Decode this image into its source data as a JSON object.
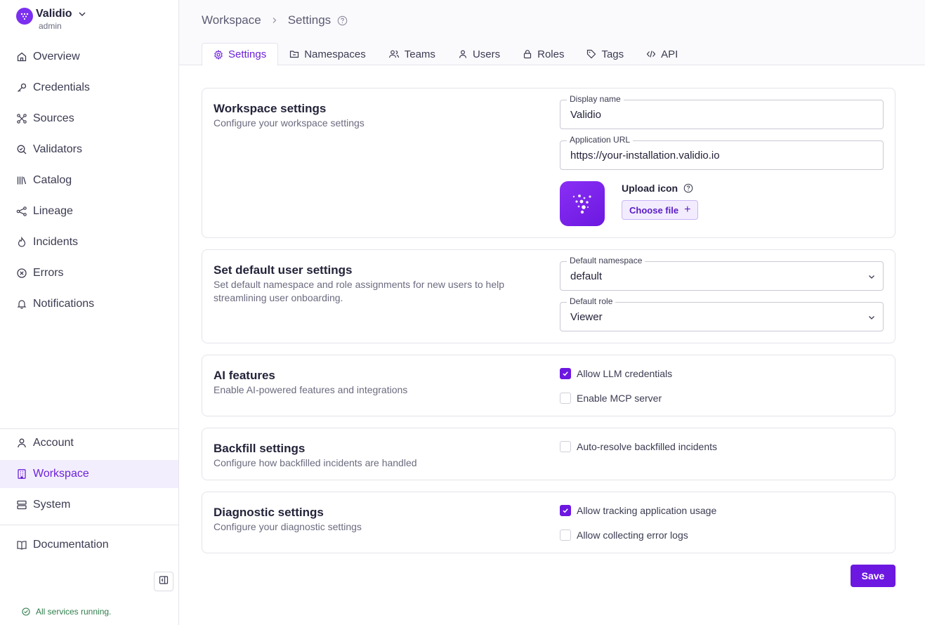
{
  "workspace": {
    "name": "Validio",
    "role": "admin"
  },
  "sidebar": {
    "main": [
      {
        "label": "Overview",
        "icon": "home-icon"
      },
      {
        "label": "Credentials",
        "icon": "key-icon"
      },
      {
        "label": "Sources",
        "icon": "sources-icon"
      },
      {
        "label": "Validators",
        "icon": "validator-icon"
      },
      {
        "label": "Catalog",
        "icon": "catalog-icon"
      },
      {
        "label": "Lineage",
        "icon": "lineage-icon"
      },
      {
        "label": "Incidents",
        "icon": "flame-icon"
      },
      {
        "label": "Errors",
        "icon": "error-icon"
      },
      {
        "label": "Notifications",
        "icon": "bell-icon"
      }
    ],
    "bottom": [
      {
        "label": "Account",
        "icon": "user-icon"
      },
      {
        "label": "Workspace",
        "icon": "building-icon",
        "active": true
      },
      {
        "label": "System",
        "icon": "server-icon"
      }
    ],
    "documentation": "Documentation",
    "status": "All services running."
  },
  "breadcrumb": {
    "root": "Workspace",
    "current": "Settings"
  },
  "tabs": [
    {
      "label": "Settings",
      "icon": "gear-icon",
      "active": true
    },
    {
      "label": "Namespaces",
      "icon": "folder-icon"
    },
    {
      "label": "Teams",
      "icon": "team-icon"
    },
    {
      "label": "Users",
      "icon": "user-icon"
    },
    {
      "label": "Roles",
      "icon": "lock-icon"
    },
    {
      "label": "Tags",
      "icon": "tag-icon"
    },
    {
      "label": "API",
      "icon": "code-icon"
    }
  ],
  "workspace_settings": {
    "title": "Workspace settings",
    "desc": "Configure your workspace settings",
    "display_name_label": "Display name",
    "display_name": "Validio",
    "app_url_label": "Application URL",
    "app_url": "https://your-installation.validio.io",
    "upload_label": "Upload icon",
    "choose_file": "Choose file",
    "plus": "+"
  },
  "user_defaults": {
    "title": "Set default user settings",
    "desc": "Set default namespace and role assignments for new users to help streamlining user onboarding.",
    "namespace_label": "Default namespace",
    "namespace": "default",
    "role_label": "Default role",
    "role": "Viewer"
  },
  "ai": {
    "title": "AI features",
    "desc": "Enable AI-powered features and integrations",
    "opt1": "Allow LLM credentials",
    "opt1_checked": true,
    "opt2": "Enable MCP server",
    "opt2_checked": false
  },
  "backfill": {
    "title": "Backfill settings",
    "desc": "Configure how backfilled incidents are handled",
    "opt1": "Auto-resolve backfilled incidents",
    "opt1_checked": false
  },
  "diagnostic": {
    "title": "Diagnostic settings",
    "desc": "Configure your diagnostic settings",
    "opt1": "Allow tracking application usage",
    "opt1_checked": true,
    "opt2": "Allow collecting error logs",
    "opt2_checked": false
  },
  "save": "Save",
  "colors": {
    "accent": "#6c18e0",
    "active_bg": "#f3eefd"
  }
}
